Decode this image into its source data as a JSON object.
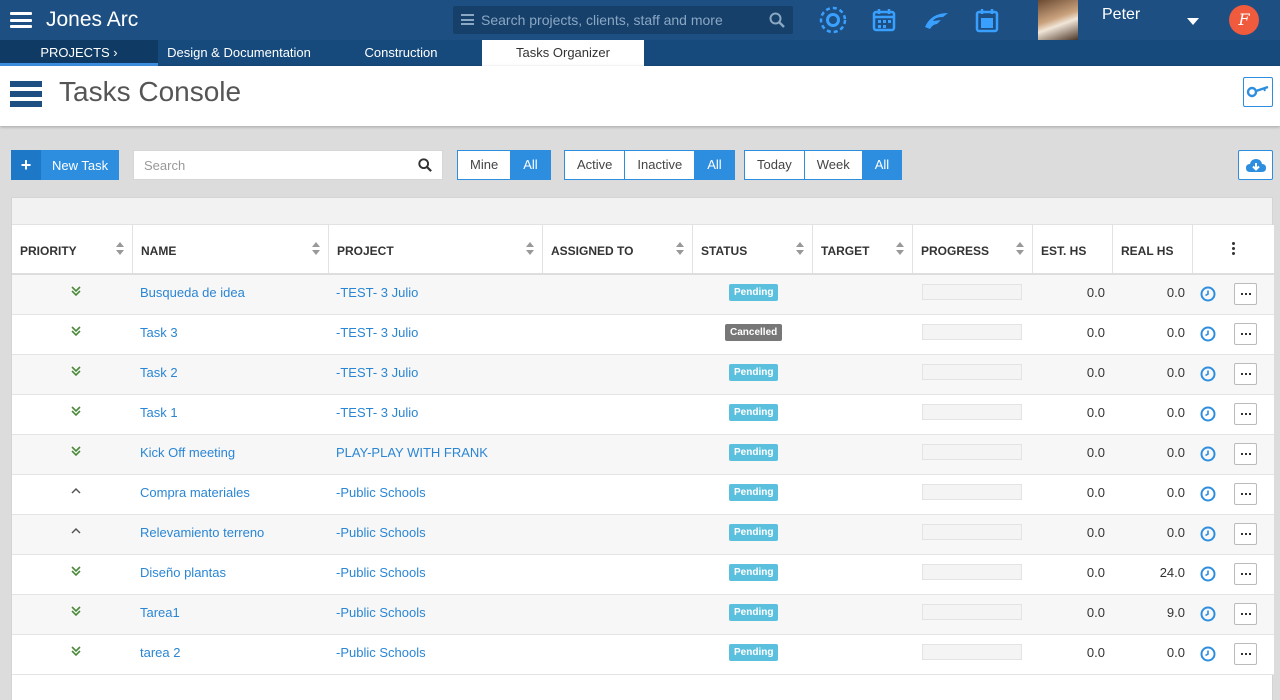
{
  "app": {
    "title": "Jones Arc",
    "search_placeholder": "Search projects, clients, staff and more",
    "user_name": "Peter",
    "brand_letter": "F",
    "accent_color": "#2d8ee0",
    "header_color": "#1d4f82"
  },
  "nav_tabs": {
    "projects": "PROJECTS  ›",
    "design": "Design & Documentation",
    "construction": "Construction",
    "tasks": "Tasks Organizer"
  },
  "page": {
    "title": "Tasks Console"
  },
  "toolbar": {
    "new_task": "New Task",
    "search_placeholder": "Search",
    "owner": {
      "mine": "Mine",
      "all": "All",
      "selected": "All"
    },
    "state": {
      "active": "Active",
      "inactive": "Inactive",
      "all": "All",
      "selected": "All"
    },
    "range": {
      "today": "Today",
      "week": "Week",
      "all": "All",
      "selected": "All"
    }
  },
  "columns": {
    "priority": "PRIORITY",
    "name": "NAME",
    "project": "PROJECT",
    "assigned_to": "ASSIGNED TO",
    "status": "STATUS",
    "target": "TARGET",
    "progress": "PROGRESS",
    "est_hs": "EST. HS",
    "real_hs": "REAL HS"
  },
  "tasks": [
    {
      "priority": "low",
      "name": "Busqueda de idea",
      "project": "-TEST- 3 Julio",
      "assigned_to": "",
      "status": "Pending",
      "target": "",
      "progress": 0,
      "est_hs": "0.0",
      "real_hs": "0.0"
    },
    {
      "priority": "low",
      "name": "Task 3",
      "project": "-TEST- 3 Julio",
      "assigned_to": "",
      "status": "Cancelled",
      "target": "",
      "progress": 0,
      "est_hs": "0.0",
      "real_hs": "0.0"
    },
    {
      "priority": "low",
      "name": "Task 2",
      "project": "-TEST- 3 Julio",
      "assigned_to": "",
      "status": "Pending",
      "target": "",
      "progress": 0,
      "est_hs": "0.0",
      "real_hs": "0.0"
    },
    {
      "priority": "low",
      "name": "Task 1",
      "project": "-TEST- 3 Julio",
      "assigned_to": "",
      "status": "Pending",
      "target": "",
      "progress": 0,
      "est_hs": "0.0",
      "real_hs": "0.0"
    },
    {
      "priority": "low",
      "name": "Kick Off meeting",
      "project": "PLAY-PLAY WITH FRANK",
      "assigned_to": "",
      "status": "Pending",
      "target": "",
      "progress": 0,
      "est_hs": "0.0",
      "real_hs": "0.0"
    },
    {
      "priority": "high",
      "name": "Compra materiales",
      "project": "-Public Schools",
      "assigned_to": "",
      "status": "Pending",
      "target": "",
      "progress": 0,
      "est_hs": "0.0",
      "real_hs": "0.0"
    },
    {
      "priority": "high",
      "name": "Relevamiento terreno",
      "project": "-Public Schools",
      "assigned_to": "",
      "status": "Pending",
      "target": "",
      "progress": 0,
      "est_hs": "0.0",
      "real_hs": "0.0"
    },
    {
      "priority": "low",
      "name": "Diseño plantas",
      "project": "-Public Schools",
      "assigned_to": "",
      "status": "Pending",
      "target": "",
      "progress": 0,
      "est_hs": "0.0",
      "real_hs": "24.0"
    },
    {
      "priority": "low",
      "name": "Tarea1",
      "project": "-Public Schools",
      "assigned_to": "",
      "status": "Pending",
      "target": "",
      "progress": 0,
      "est_hs": "0.0",
      "real_hs": "9.0"
    },
    {
      "priority": "low",
      "name": "tarea 2",
      "project": "-Public Schools",
      "assigned_to": "",
      "status": "Pending",
      "target": "",
      "progress": 0,
      "est_hs": "0.0",
      "real_hs": "0.0"
    }
  ],
  "icons": {
    "menu": "hamburger-menu-icon",
    "search": "magnifier-icon",
    "timer": "timer-icon",
    "calendar": "calendar-icon",
    "brand": "wing-logo-icon",
    "date": "date-calendar-icon",
    "key": "key-icon",
    "download": "cloud-download-icon",
    "clock": "clock-icon",
    "more": "ellipsis-icon"
  }
}
